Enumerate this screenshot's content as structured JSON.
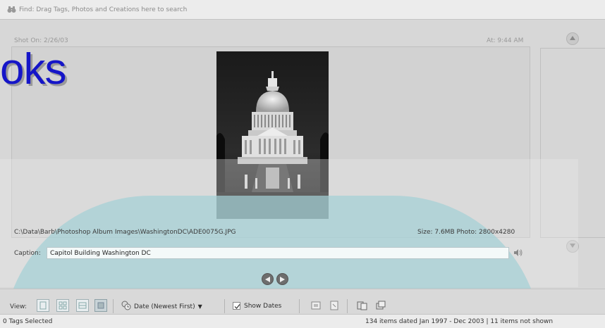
{
  "find_bar": {
    "text": "Find: Drag Tags, Photos and Creations here to search",
    "icon": "binoculars-icon"
  },
  "photo_panel": {
    "shot_on": "Shot On: 2/26/03",
    "shot_at": "At: 9:44 AM",
    "overlay_text": "oks",
    "path": "C:\\Data\\Barb\\Photoshop Album Images\\WashingtonDC\\ADE0075G.JPG",
    "size_info": "Size: 7.6MB  Photo: 2800x4280",
    "caption_label": "Caption:",
    "caption_value": "Capitol Building Washington DC"
  },
  "toolbar": {
    "view_label": "View:",
    "sort_label": "Date (Newest First)",
    "show_dates_label": "Show Dates",
    "show_dates_checked": true
  },
  "status": {
    "left": "0 Tags Selected",
    "right": "134 items dated Jan 1997 - Dec 2003  |  11 items not shown"
  },
  "colors": {
    "overlay_text": "#1515c8",
    "teal_overlay": "#a3d0d6"
  }
}
